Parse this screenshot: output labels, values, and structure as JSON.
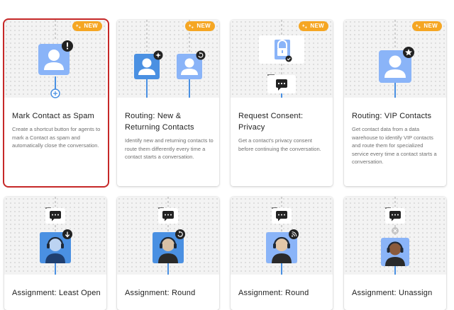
{
  "badge_text": "NEW",
  "colors": {
    "accent_blue": "#4a90e2",
    "light_blue": "#8ab4f8",
    "badge_orange": "#f5a623",
    "selection_red": "#c62828"
  },
  "cards": [
    {
      "title": "Mark Contact as Spam",
      "description": "Create a shortcut button for agents to mark a Contact as spam and automatically close the conversation.",
      "badge": true,
      "selected": true
    },
    {
      "title": "Routing: New & Returning Contacts",
      "description": "Identify new and returning contacts to route them differently every time a contact starts a conversation.",
      "badge": true,
      "selected": false
    },
    {
      "title": "Request Consent: Privacy",
      "description": "Get a contact's privacy consent before continuing the conversation.",
      "badge": true,
      "selected": false
    },
    {
      "title": "Routing: VIP Contacts",
      "description": "Get contact data from a data warehouse to identify VIP contacts and route them for specialized service every time a contact starts a conversation.",
      "badge": true,
      "selected": false
    },
    {
      "title": "Assignment: Least Open",
      "badge": false
    },
    {
      "title": "Assignment: Round",
      "badge": false
    },
    {
      "title": "Assignment: Round",
      "badge": false
    },
    {
      "title": "Assignment: Unassign",
      "badge": false
    }
  ]
}
